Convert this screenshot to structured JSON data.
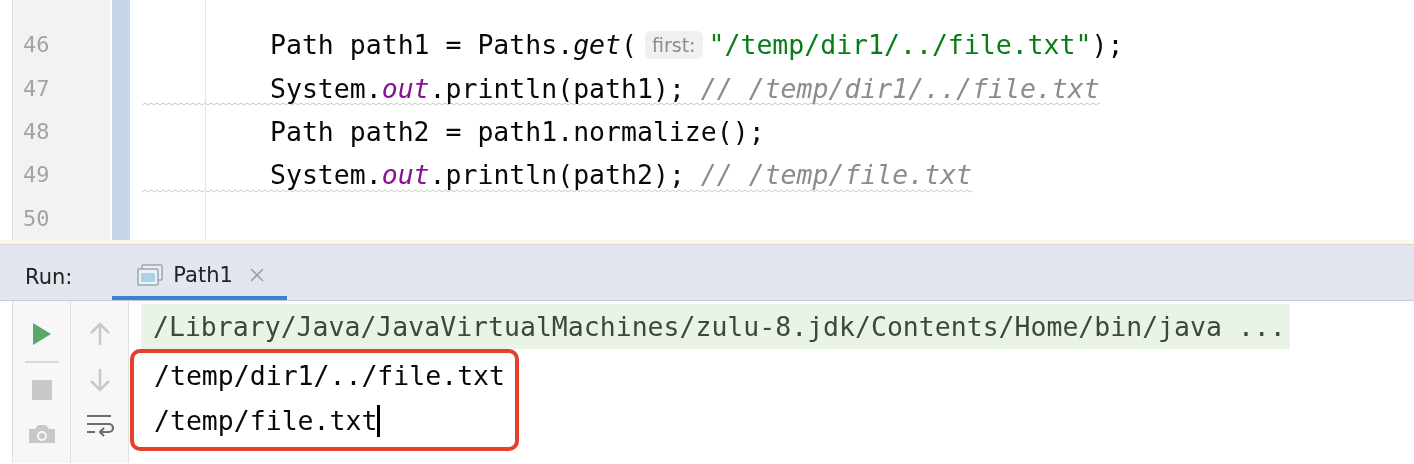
{
  "editor": {
    "lines": [
      {
        "number": "46",
        "warning": false,
        "tokens": [
          {
            "kind": "text",
            "text": "Path path1 = Paths."
          },
          {
            "kind": "method",
            "text": "get"
          },
          {
            "kind": "text",
            "text": "("
          },
          {
            "kind": "hint",
            "text": "first:"
          },
          {
            "kind": "string",
            "text": "\"/temp/dir1/../file.txt\""
          },
          {
            "kind": "text",
            "text": ");"
          }
        ]
      },
      {
        "number": "47",
        "warning": true,
        "tokens": [
          {
            "kind": "text",
            "text": "System."
          },
          {
            "kind": "field",
            "text": "out"
          },
          {
            "kind": "text",
            "text": ".println(path1);"
          },
          {
            "kind": "comment",
            "text": "// /temp/dir1/../file.txt"
          }
        ]
      },
      {
        "number": "48",
        "warning": false,
        "tokens": [
          {
            "kind": "text",
            "text": "Path path2 = path1.normalize();"
          }
        ]
      },
      {
        "number": "49",
        "warning": true,
        "tokens": [
          {
            "kind": "text",
            "text": "System."
          },
          {
            "kind": "field",
            "text": "out"
          },
          {
            "kind": "text",
            "text": ".println(path2);"
          },
          {
            "kind": "comment",
            "text": "// /temp/file.txt"
          }
        ]
      },
      {
        "number": "50",
        "warning": false
      }
    ]
  },
  "run_panel": {
    "label": "Run:",
    "tabs": [
      {
        "title": "Path1",
        "selected": true
      }
    ],
    "toolbar": [
      {
        "kind": "run",
        "disabled": false
      },
      {
        "kind": "stop",
        "disabled": true
      },
      {
        "kind": "camera",
        "disabled": true
      }
    ],
    "toolbar_2": [
      {
        "kind": "up",
        "disabled": true
      },
      {
        "kind": "down",
        "disabled": true
      },
      {
        "kind": "wrap",
        "disabled": false
      }
    ],
    "console": {
      "command": "/Library/Java/JavaVirtualMachines/zulu-8.jdk/Contents/Home/bin/java ...",
      "output": [
        "/temp/dir1/../file.txt",
        "/temp/file.txt"
      ],
      "output_highlighted": true,
      "cursor": true
    }
  }
}
